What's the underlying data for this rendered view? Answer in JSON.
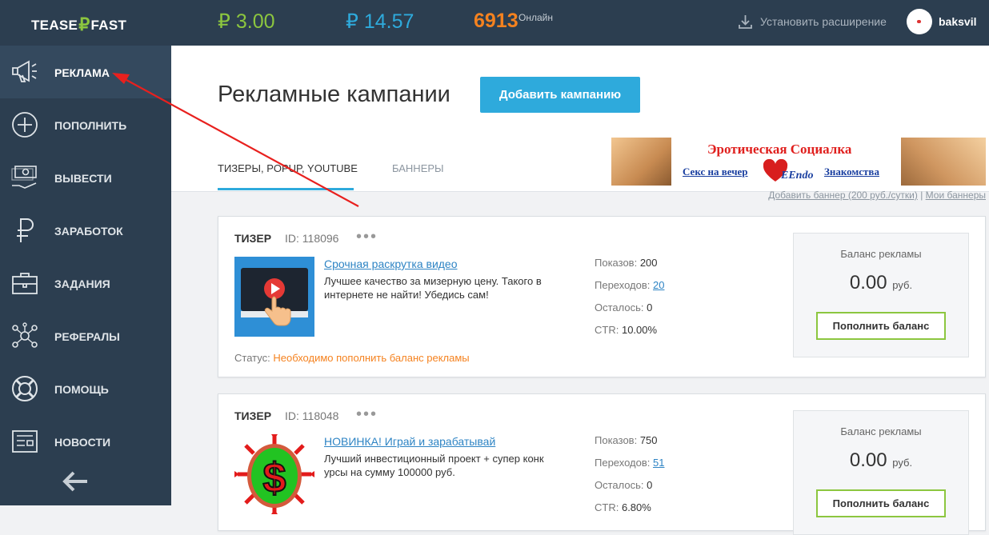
{
  "topbar": {
    "logo_left": "TEASE",
    "logo_symbol": "₽",
    "logo_right": "FAST",
    "balance_green": "₽ 3.00",
    "balance_blue": "₽ 14.57",
    "online_count": "6913",
    "online_label": "Онлайн",
    "extension_label": "Установить расширение",
    "username": "baksvil"
  },
  "sidebar": {
    "items": [
      {
        "label": "РЕКЛАМА"
      },
      {
        "label": "ПОПОЛНИТЬ"
      },
      {
        "label": "ВЫВЕСТИ"
      },
      {
        "label": "ЗАРАБОТОК"
      },
      {
        "label": "ЗАДАНИЯ"
      },
      {
        "label": "РЕФЕРАЛЫ"
      },
      {
        "label": "ПОМОЩЬ"
      },
      {
        "label": "НОВОСТИ"
      }
    ]
  },
  "header": {
    "title": "Рекламные кампании",
    "add_button": "Добавить кампанию",
    "tabs": [
      {
        "label": "ТИЗЕРЫ, POPUP, YOUTUBE"
      },
      {
        "label": "БАННЕРЫ"
      }
    ]
  },
  "banner": {
    "title": "Эротическая Социалка",
    "left_link": "Секс на вечер",
    "logo_text": "EEndo",
    "right_link": "Знакомства",
    "add_link": "Добавить баннер (200 руб./сутки)",
    "separator": "|",
    "my_link": "Мои баннеры"
  },
  "campaigns": [
    {
      "type": "ТИЗЕР",
      "id": "ID: 118096",
      "title": "Срочная раскрутка видео",
      "desc": "Лучшее качество за мизерную цену. Такого в интернете не найти! Убедись сам!",
      "views_label": "Показов:",
      "views": "200",
      "clicks_label": "Переходов:",
      "clicks": "20",
      "left_label": "Осталось:",
      "left": "0",
      "ctr_label": "CTR:",
      "ctr": "10.00%",
      "status_label": "Статус:",
      "status": "Необходимо пополнить баланс рекламы",
      "balance_title": "Баланс рекламы",
      "balance": "0.00",
      "currency": "руб.",
      "topup": "Пополнить баланс"
    },
    {
      "type": "ТИЗЕР",
      "id": "ID: 118048",
      "title": "НОВИНКА! Играй и зарабатывай",
      "desc": "Лучший инвестиционный проект + супер конк урсы на сумму 100000 руб.",
      "views_label": "Показов:",
      "views": "750",
      "clicks_label": "Переходов:",
      "clicks": "51",
      "left_label": "Осталось:",
      "left": "0",
      "ctr_label": "CTR:",
      "ctr": "6.80%",
      "balance_title": "Баланс рекламы",
      "balance": "0.00",
      "currency": "руб.",
      "topup": "Пополнить баланс"
    }
  ],
  "colors": {
    "sidebar_bg": "#2c3e50",
    "accent_blue": "#2eaadc",
    "accent_green": "#8cc63f",
    "accent_orange": "#f5821f",
    "annotation_arrow": "#e8201e"
  }
}
